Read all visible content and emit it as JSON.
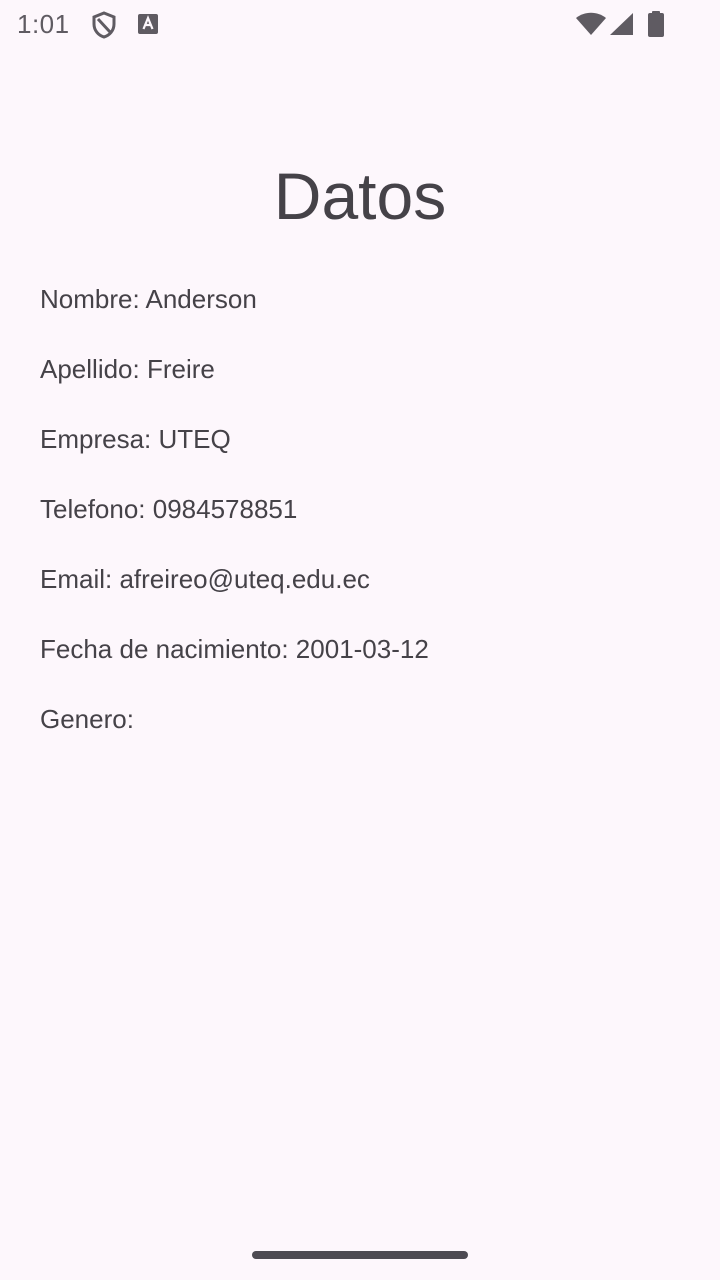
{
  "status_bar": {
    "time": "1:01",
    "icons_left": [
      "shield-icon",
      "text-a-icon"
    ],
    "icons_right": [
      "wifi-icon",
      "signal-icon",
      "battery-icon"
    ]
  },
  "page": {
    "title": "Datos"
  },
  "fields": {
    "nombre": "Nombre: Anderson",
    "apellido": "Apellido: Freire",
    "empresa": "Empresa: UTEQ",
    "telefono": "Telefono: 0984578851",
    "email": "Email: afreireo@uteq.edu.ec",
    "fecha_nacimiento": "Fecha de nacimiento: 2001-03-12",
    "genero": "Genero:"
  },
  "colors": {
    "background": "#fdf7fc",
    "text": "#454248"
  }
}
